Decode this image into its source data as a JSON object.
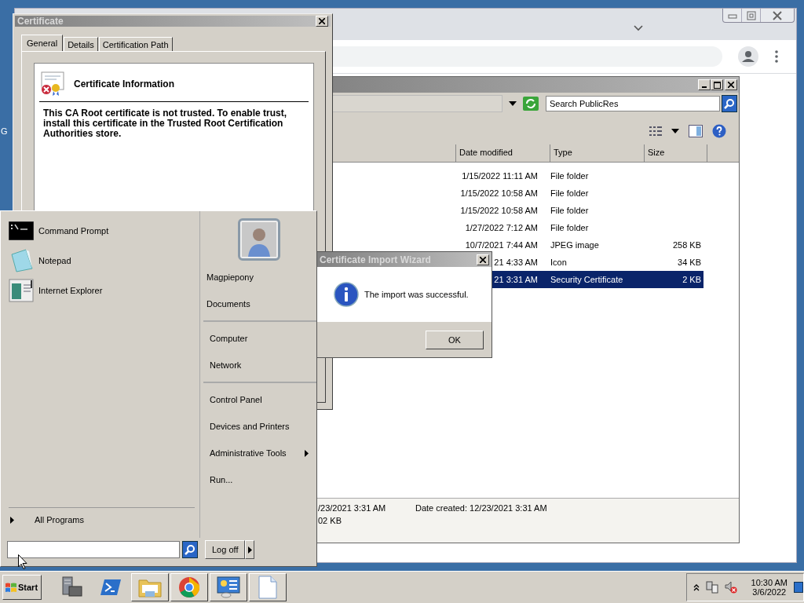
{
  "desktop": {
    "icon_label": "G"
  },
  "certificate_dialog": {
    "title": "Certificate",
    "tabs": [
      {
        "label": "General",
        "selected": true
      },
      {
        "label": "Details",
        "selected": false
      },
      {
        "label": "Certification Path",
        "selected": false
      }
    ],
    "heading": "Certificate Information",
    "message": "This CA Root certificate is not trusted. To enable trust, install this certificate in the Trusted Root Certification Authorities store."
  },
  "explorer": {
    "search": {
      "placeholder": "Search PublicRes"
    },
    "columns": [
      "Date modified",
      "Type",
      "Size"
    ],
    "rows": [
      {
        "date": "1/15/2022 11:11 AM",
        "type": "File folder",
        "selected": false
      },
      {
        "date": "1/15/2022 10:58 AM",
        "type": "File folder",
        "selected": false
      },
      {
        "date": "1/15/2022 10:58 AM",
        "type": "File folder",
        "selected": false
      },
      {
        "date": "1/27/2022 7:12 AM",
        "type": "File folder",
        "selected": false
      },
      {
        "date": "10/7/2021 7:44 AM",
        "type": "JPEG image",
        "size": "258 KB",
        "selected": false
      },
      {
        "date": "21 4:33 AM",
        "type": "Icon",
        "size": "34 KB",
        "selected": false
      },
      {
        "date": "21 3:31 AM",
        "type": "Security Certificate",
        "size": "2 KB",
        "selected": true
      }
    ],
    "details": {
      "modified": "/23/2021 3:31 AM",
      "created": "Date created: 12/23/2021 3:31 AM",
      "size": "02 KB"
    }
  },
  "start_menu": {
    "programs": [
      {
        "label": "Command Prompt",
        "kind": "cmd"
      },
      {
        "label": "Notepad",
        "kind": "notepad"
      },
      {
        "label": "Internet Explorer",
        "kind": "ie"
      }
    ],
    "all_programs": "All Programs",
    "place_groups": [
      {
        "items": [
          {
            "label": "Magpiepony",
            "has_submenu": false
          },
          {
            "label": "Documents",
            "has_submenu": false
          }
        ]
      },
      {
        "items": [
          {
            "label": "Computer",
            "has_submenu": false
          },
          {
            "label": "Network",
            "has_submenu": false
          }
        ]
      },
      {
        "items": [
          {
            "label": "Control Panel",
            "has_submenu": false
          },
          {
            "label": "Devices and Printers",
            "has_submenu": false
          },
          {
            "label": "Administrative Tools",
            "has_submenu": true
          },
          {
            "label": "Run...",
            "has_submenu": false
          }
        ]
      }
    ],
    "log_off": "Log off"
  },
  "wizard": {
    "title": "Certificate Import Wizard",
    "message": "The import was successful.",
    "button": "OK"
  },
  "taskbar": {
    "start": "Start",
    "apps": [
      {
        "kind": "server",
        "open": false
      },
      {
        "kind": "powershell",
        "open": false
      },
      {
        "kind": "folder",
        "open": true
      },
      {
        "kind": "chrome",
        "open": true
      },
      {
        "kind": "control",
        "open": true
      },
      {
        "kind": "notepad",
        "open": true
      }
    ],
    "clock": {
      "time": "10:30 AM",
      "date": "3/6/2022"
    }
  }
}
